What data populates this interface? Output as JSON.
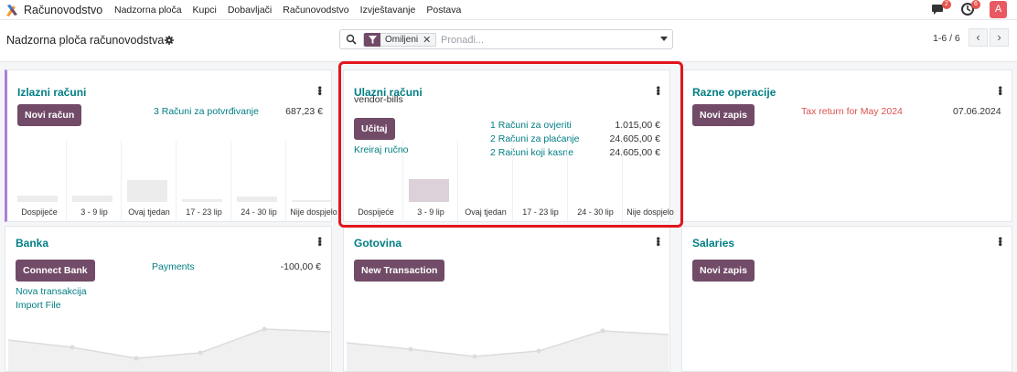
{
  "navbar": {
    "app_name": "Računovodstvo",
    "menu": [
      "Nadzorna ploča",
      "Kupci",
      "Dobavljači",
      "Računovodstvo",
      "Izvještavanje",
      "Postava"
    ],
    "messages_badge": "2",
    "activities_badge": "6",
    "avatar_letter": "A"
  },
  "control": {
    "title": "Nadzorna ploča računovodstva",
    "facet_label": "Omiljeni",
    "search_placeholder": "Pronađi...",
    "pager": "1-6 / 6"
  },
  "cards": {
    "izlazni": {
      "title": "Izlazni računi",
      "button": "Novi račun",
      "link": "3 Računi za potvrđivanje",
      "amount": "687,23 €",
      "bar_labels": [
        "Dospijeće",
        "3 - 9 lip",
        "Ovaj tjedan",
        "17 - 23 lip",
        "24 - 30 lip",
        "Nije dospjelo"
      ],
      "bar_values": [
        0.12,
        0.12,
        0.4,
        0.05,
        0.1,
        0.04
      ]
    },
    "ulazni": {
      "title": "Ulazni računi",
      "subtitle": "vendor-bills",
      "button": "Učitaj",
      "link": "Kreiraj ručno",
      "rows": [
        {
          "label": "1 Računi za ovjeriti",
          "amount": "1.015,00 €"
        },
        {
          "label": "2 Računi za plaćanje",
          "amount": "24.605,00 €"
        },
        {
          "label": "2 Računi koji kasne",
          "amount": "24.605,00 €"
        }
      ],
      "bar_labels": [
        "Dospijeće",
        "3 - 9 lip",
        "Ovaj tjedan",
        "17 - 23 lip",
        "24 - 30 lip",
        "Nije dospjelo"
      ],
      "bar_values": [
        0,
        0.42,
        0,
        0,
        0,
        0
      ]
    },
    "razne": {
      "title": "Razne operacije",
      "button": "Novi zapis",
      "alert": "Tax return for May 2024",
      "date": "07.06.2024"
    },
    "banka": {
      "title": "Banka",
      "button": "Connect Bank",
      "payments_label": "Payments",
      "payments_amount": "-100,00 €",
      "link1": "Nova transakcija",
      "link2": "Import File"
    },
    "gotovina": {
      "title": "Gotovina",
      "button": "New Transaction"
    },
    "salaries": {
      "title": "Salaries",
      "button": "Novi zapis"
    }
  },
  "colors": {
    "primary": "#714b67",
    "link": "#017e84",
    "highlight": "#e0161c",
    "alert": "#d9534f"
  }
}
